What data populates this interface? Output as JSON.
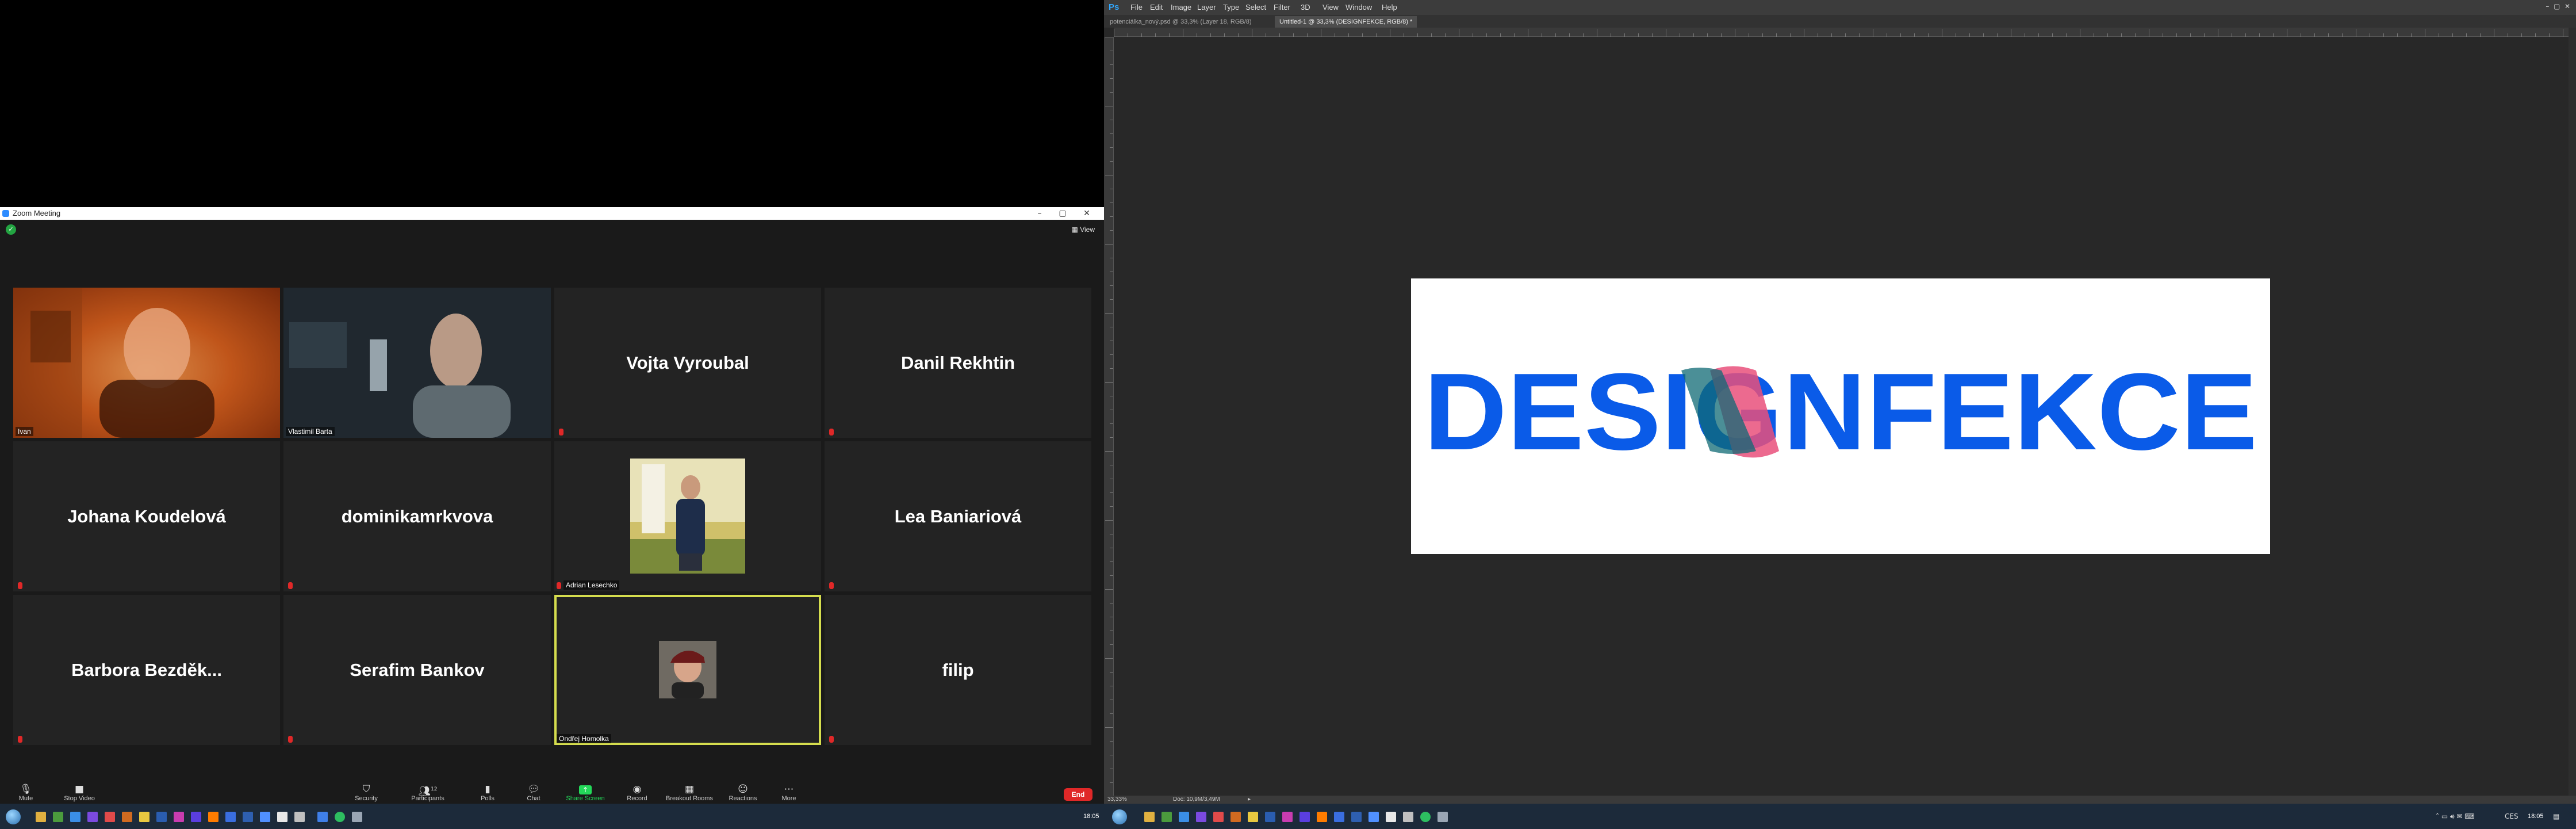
{
  "zoom": {
    "title": "Zoom Meeting",
    "view_label": "View",
    "participants": [
      {
        "name": "Ivan",
        "video": true
      },
      {
        "name": "Vlastimil Barta",
        "video": true
      },
      {
        "name": "Vojta Vyroubal",
        "video": false
      },
      {
        "name": "Danil Rekhtin",
        "video": false
      },
      {
        "name": "Johana Koudelová",
        "video": false
      },
      {
        "name": "dominikamrkvova",
        "video": false
      },
      {
        "name": "Adrian Lesechko",
        "video": true
      },
      {
        "name": "Lea Baniariová",
        "video": false
      },
      {
        "name": "Barbora  Bezděk...",
        "video": false
      },
      {
        "name": "Serafim Bankov",
        "video": false
      },
      {
        "name": "Ondřej Homolka",
        "video": true
      },
      {
        "name": "filip",
        "video": false
      }
    ],
    "toolbar": {
      "mute": "Mute",
      "stop_video": "Stop Video",
      "security": "Security",
      "participants": "Participants",
      "participants_count": "12",
      "polls": "Polls",
      "chat": "Chat",
      "share_screen": "Share Screen",
      "record": "Record",
      "breakout_rooms": "Breakout Rooms",
      "reactions": "Reactions",
      "more": "More",
      "end": "End"
    }
  },
  "photoshop": {
    "menu": [
      "File",
      "Edit",
      "Image",
      "Layer",
      "Type",
      "Select",
      "Filter",
      "3D",
      "View",
      "Window",
      "Help"
    ],
    "tabs": [
      {
        "label": "potenciálka_nový.psd @ 33,3% (Layer 18, RGB/8)",
        "active": false
      },
      {
        "label": "Untitled-1 @ 33,3% (DESIGNFEKCE, RGB/8) *",
        "active": true
      }
    ],
    "artwork_text": "DESIGNFEKCE",
    "zoom_level": "33,33%",
    "doc_size": "Doc: 10,9M/3,49M",
    "colors": {
      "blue": "#0a5be8",
      "pink": "#e9507b",
      "teal": "#0f6a74"
    }
  },
  "taskbar": {
    "left_clock": "18:05",
    "right_clock": "18:05",
    "lang": "CES"
  }
}
